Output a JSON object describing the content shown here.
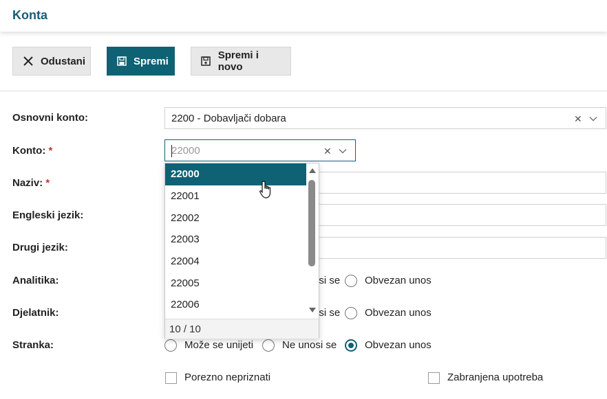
{
  "header": {
    "title": "Konta"
  },
  "toolbar": {
    "cancel_label": "Odustani",
    "save_label": "Spremi",
    "save_new_label": "Spremi i novo"
  },
  "form": {
    "osnovni_konto": {
      "label": "Osnovni konto:",
      "value": "2200 - Dobavljači dobara"
    },
    "konto": {
      "label": "Konto:",
      "required": "*",
      "value": "22000"
    },
    "naziv": {
      "label": "Naziv:",
      "required": "*"
    },
    "engleski": {
      "label": "Engleski jezik:"
    },
    "drugi": {
      "label": "Drugi jezik:"
    },
    "analitika": {
      "label": "Analitika:",
      "opt_ne_partial": "osi se",
      "opt_obvezan": "Obvezan unos"
    },
    "djelatnik": {
      "label": "Djelatnik:",
      "opt_ne_partial": "osi se",
      "opt_obvezan": "Obvezan unos"
    },
    "stranka": {
      "label": "Stranka:",
      "opt_moze": "Može se unijeti",
      "opt_ne": "Ne unosi se",
      "opt_obvezan": "Obvezan unos",
      "selected": "Obvezan unos"
    },
    "porezno": {
      "label": "Porezno nepriznati",
      "checked": false
    },
    "zabranjena": {
      "label": "Zabranjena upotreba",
      "checked": false
    }
  },
  "dropdown": {
    "options": [
      "22000",
      "22001",
      "22002",
      "22003",
      "22004",
      "22005",
      "22006"
    ],
    "selected": "22000",
    "footer": "10 / 10"
  },
  "colors": {
    "accent": "#0f6174",
    "title": "#1b5c73",
    "required": "#c9302c"
  }
}
